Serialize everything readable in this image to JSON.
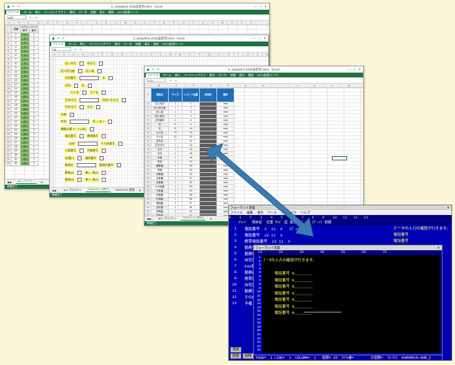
{
  "win1": {
    "title": "k_sample01.DSD設定例.xlsm - Excel",
    "namebox": "A89",
    "tabs": [
      "ファイル",
      "ホーム",
      "挿入",
      "ページレイアウト",
      "数式",
      "データ",
      "校閲",
      "表示",
      "開発",
      "AFX4拡張ツール"
    ],
    "headers": [
      "項番",
      "カラム番号",
      "ページ番号"
    ],
    "rows": [
      [
        "1",
        "1",
        "1"
      ],
      [
        "2",
        "2",
        "1"
      ],
      [
        "3",
        "3",
        "1"
      ],
      [
        "4",
        "4",
        "1"
      ],
      [
        "5",
        "5",
        "1"
      ],
      [
        "6",
        "6",
        "1"
      ],
      [
        "7",
        "7",
        "1"
      ],
      [
        "8",
        "8",
        "1"
      ],
      [
        "9",
        "9",
        "1"
      ],
      [
        "10",
        "10",
        "1"
      ],
      [
        "11",
        "11",
        "1"
      ],
      [
        "12",
        "12",
        "1"
      ],
      [
        "13",
        "13",
        "1"
      ],
      [
        "14",
        "14",
        "1"
      ],
      [
        "15",
        "15",
        "1"
      ],
      [
        "16",
        "16",
        "1"
      ],
      [
        "17",
        "17",
        "1"
      ],
      [
        "18",
        "18",
        "1"
      ],
      [
        "19",
        "19",
        "1"
      ],
      [
        "20",
        "20",
        "1"
      ],
      [
        "21",
        "21",
        "1"
      ],
      [
        "22",
        "22",
        "1"
      ],
      [
        "23",
        "23",
        "1"
      ],
      [
        "24",
        "24",
        "1"
      ],
      [
        "25",
        "25",
        "1"
      ],
      [
        "26",
        "26",
        "1"
      ],
      [
        "27",
        "27",
        "1"
      ],
      [
        "28",
        "28",
        "1"
      ],
      [
        "29",
        "29",
        "1"
      ],
      [
        "30",
        "30",
        "1"
      ],
      [
        "31",
        "31",
        "1"
      ],
      [
        "32",
        "32",
        "1"
      ]
    ],
    "sheet_tab": "qu1.プロパティ",
    "status": "準備完了"
  },
  "win2": {
    "title": "k_sample01.DSD設定例.xlsm - Excel",
    "namebox": "A1",
    "tabs": [
      "ファイル",
      "ホーム",
      "挿入",
      "ページレイアウト",
      "数式",
      "データ",
      "校閲",
      "表示",
      "開発",
      "AFX4拡張ツール"
    ],
    "form": [
      {
        "label": "記入年月",
        "extra": "年月日"
      },
      {
        "label": "記入担当者",
        "extra": "記入者"
      },
      {
        "label": "住所番号",
        "extra": "名"
      },
      {
        "label": "住所",
        "extra": "名"
      },
      {
        "label": "カナ名",
        "extra": "カナ名"
      },
      {
        "label": "生年月日",
        "extra": "住所1 年月日"
      },
      {
        "label": "生年月日",
        "extra": "生月"
      },
      {
        "label": "年齢",
        "extra": ""
      },
      {
        "label": "性別",
        "extra": "男 1, 女 2"
      },
      {
        "label": "職業分類コード(2桁)",
        "extra": ""
      },
      {
        "label": "電話番号",
        "extra": "携帯番号"
      },
      {
        "label": "自宅",
        "extra": "その他番号"
      },
      {
        "label": "大阪番号",
        "extra": "京都番号"
      },
      {
        "label": "札幌(F)",
        "extra": "福岡番号"
      },
      {
        "label": "勤務先",
        "extra": "勤務先番号"
      },
      {
        "label": "勤務(A)",
        "extra": "無い, 無(0)"
      },
      {
        "label": "勤務(B)",
        "extra": "無い, 無(0)"
      }
    ],
    "sheet_tabs": [
      "qu1.プロパティ",
      "SAMPLE01.固有式",
      "SAMPLE01.関連"
    ],
    "status": "準備完了"
  },
  "win3": {
    "title": "k_sample01.DSD設定例.xlsm - Excel",
    "namebox": "L19",
    "tabs": [
      "ファイル",
      "ホーム",
      "挿入",
      "ページレイアウト",
      "数式",
      "データ",
      "校閲",
      "表示",
      "開発",
      "AFX4拡張ツール"
    ],
    "col_letters": [
      "B",
      "C",
      "D",
      "E",
      "F",
      "G",
      "H",
      "I",
      "J",
      "K",
      "L",
      "M"
    ],
    "headers": [
      "項目名",
      "サイズ",
      "レコード位置",
      "日時表",
      "備考"
    ],
    "rows": [
      [
        "記入年月",
        "1",
        "1",
        "",
        "mes"
      ],
      [
        "記入担当者",
        "1",
        "2",
        "",
        "mes"
      ],
      [
        "記入者",
        "1",
        "3",
        "",
        "mes"
      ],
      [
        "記入者名",
        "1",
        "4",
        "",
        "mes"
      ],
      [
        "住所番号",
        "1",
        "5",
        "",
        "mes"
      ],
      [
        "住",
        "8",
        "6",
        "",
        "mes"
      ],
      [
        "名",
        "8",
        "14",
        "",
        "mes"
      ],
      [
        "カナ住",
        "10",
        "22",
        "",
        "mes"
      ],
      [
        "カナ名",
        "10",
        "32",
        "",
        "mes"
      ],
      [
        "生年月",
        "1",
        "42",
        "",
        "mes"
      ],
      [
        "生年月日",
        "1",
        "43",
        "",
        "mes"
      ],
      [
        "生月",
        "1",
        "44",
        "",
        "mes"
      ],
      [
        "生日",
        "1",
        "45",
        "",
        "mes"
      ],
      [
        "年齢",
        "1",
        "46",
        "",
        "mes"
      ],
      [
        "性別",
        "1",
        "47",
        "",
        "mes"
      ],
      [
        "職業番",
        "1",
        "48",
        "",
        "mes"
      ],
      [
        "勤務",
        "1",
        "49",
        "",
        "mes"
      ],
      [
        "京都番",
        "1",
        "50",
        "",
        "mes"
      ],
      [
        "京都番",
        "1",
        "51",
        "",
        "mes"
      ],
      [
        "京都番",
        "1",
        "52",
        "",
        "mes"
      ],
      [
        "その他番",
        "1",
        "53",
        "",
        "mes"
      ],
      [
        "大阪番",
        "1",
        "54",
        "",
        "mes"
      ],
      [
        "京都番",
        "1",
        "55",
        "",
        "mes"
      ],
      [
        "札幌番",
        "1",
        "56",
        "",
        "mes"
      ],
      [
        "福岡番",
        "1",
        "57",
        "",
        "mes"
      ],
      [
        "自宅番",
        "1",
        "58",
        "",
        "mes"
      ],
      [
        "勤務番",
        "1",
        "59",
        "",
        "mes"
      ],
      [
        "勤務番",
        "1",
        "60",
        "",
        "mes"
      ],
      [
        "携帯番",
        "1",
        "61",
        "",
        "mes"
      ],
      [
        "勤務",
        "1",
        "62",
        "",
        "mes"
      ],
      [
        "勤務先",
        "1",
        "63",
        "",
        "mes"
      ],
      [
        "勤務番",
        "1",
        "64",
        "",
        "mes"
      ],
      [
        "その他",
        "1",
        "65",
        "",
        "mes"
      ]
    ],
    "sheet_tabs": [
      "qu1.プロパティ",
      "SAMPLE01.固有式"
    ],
    "status": "準備完了"
  },
  "editor_back": {
    "title": "フォーマット定義",
    "menu": [
      "ファイル",
      "編集",
      "表示",
      "ツール",
      "ウィンドウ",
      "ヘルプ"
    ],
    "ruler": "0    1    2    3    4    5    6    7    8    9    10   11   12   13",
    "header_row": "#ｺｰﾄﾞ  項目名  位置 ｻｲｽﾞ 型 属性  ﾃﾞｰﾀ  ｴﾃﾞｨｯﾄ 初期",
    "lines": [
      {
        "n": "1",
        "text": "  電話番号  1  11  X   ｴﾃﾞｨｯﾄ "
      },
      {
        "n": "2",
        "text": "  電話番号  12 11  X"
      },
      {
        "n": "3",
        "text": "  携帯電話番号  23 11  X"
      },
      {
        "n": "4",
        "text": "  勤務先電話番号  34 11  X"
      },
      {
        "n": "5",
        "text": "  勤務電話番号  45 11  X"
      },
      {
        "n": "6",
        "text": "  自宅電話番号  56 11  X"
      },
      {
        "n": "7",
        "text": "  FAX番号  67 11  X"
      },
      {
        "n": "8",
        "text": "  勤務FAX  78 11  X"
      },
      {
        "n": "9",
        "text": "  携帯番号2  89 11  X"
      },
      {
        "n": "10",
        "text": "  自宅番号2  100 11  X"
      },
      {
        "n": "11",
        "text": "  勤務先番号2  111 11  X"
      },
      {
        "n": "12",
        "text": "  その他  122 11  X"
      },
      {
        "n": "13",
        "text": "  予備  133 11  X"
      }
    ],
    "side_label": "電話番号",
    "note": "データの入力の確認が行きます。",
    "buttons": [
      "項目",
      "前後",
      "削除"
    ]
  },
  "editor_front": {
    "title": "フォーマット定義",
    "ruler": "  10        20        30        40        50        60        70",
    "top_text": "ﾃﾞｰﾀの入力の確認が行きます。",
    "phone_label": "電話番号 N",
    "phone_count": 7,
    "line_numbers": [
      "1",
      "2",
      "3",
      "4",
      "5",
      "6",
      "7",
      "8",
      "9",
      "10",
      "11",
      "12",
      "13",
      "14",
      "15",
      "16",
      "17",
      "18",
      "19",
      "20",
      "21",
      "22",
      "23",
      "24",
      "25"
    ],
    "status": "PAGE=  1 LINE=  1  COLUMN=  1   総数= 15  ｱｲﾃﾑ番=        分割数=  ﾌｫｰﾏｯﾄ  KUROMOJO.NOR_2"
  },
  "colors": {
    "excel_green": "#217346",
    "header_blue": "#1b6fb8",
    "editor_blue": "#0000b4",
    "arrow": "#3a7bb4"
  }
}
